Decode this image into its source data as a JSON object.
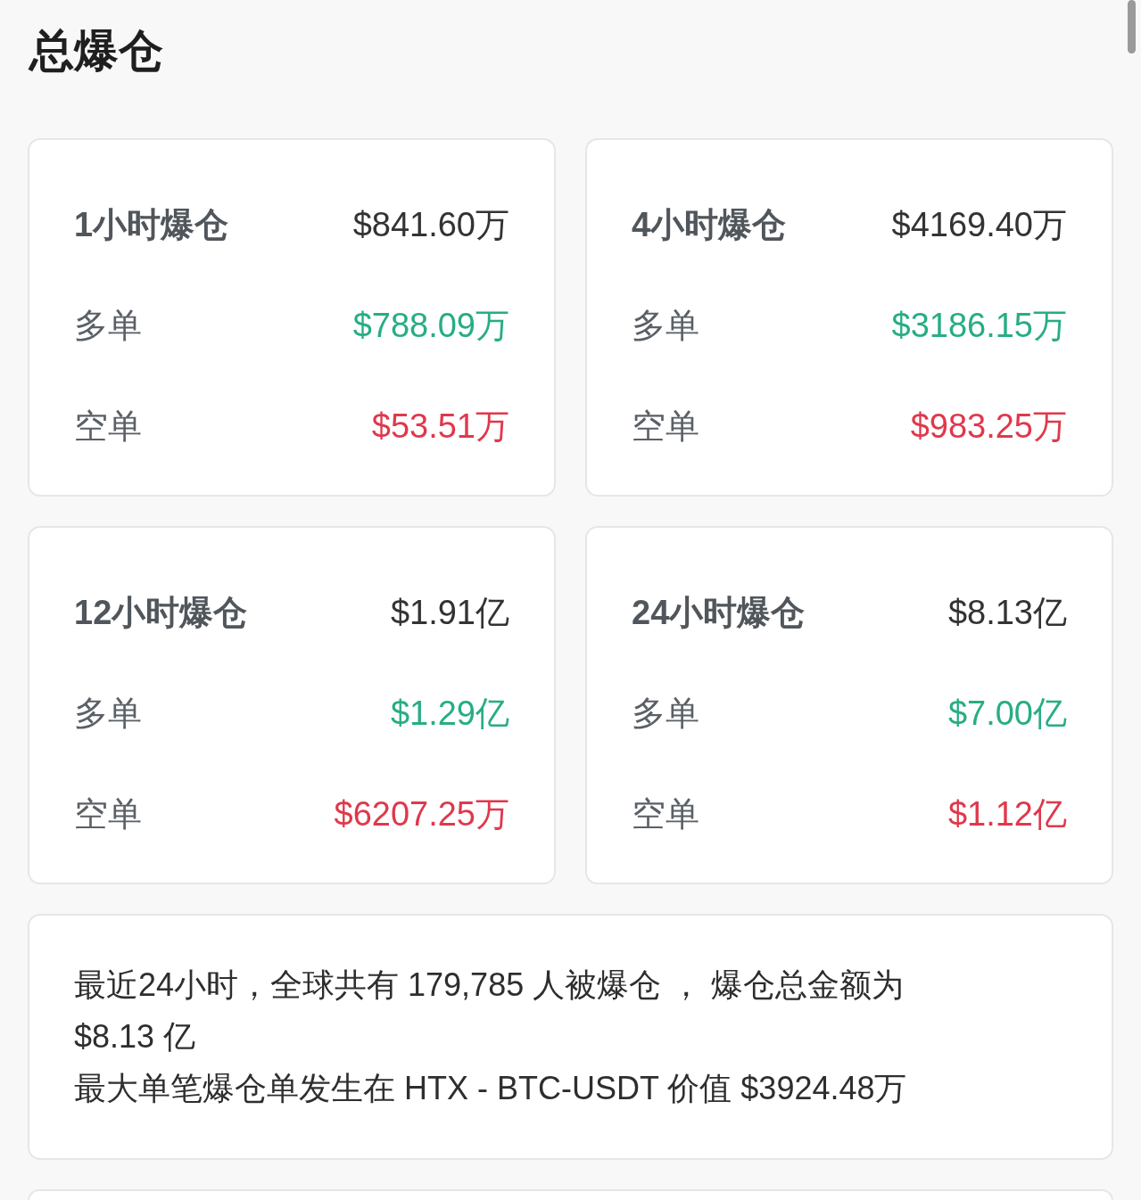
{
  "title": "总爆仓",
  "periods": [
    {
      "label": "1小时爆仓",
      "total": "$841.60万",
      "rows": [
        {
          "kind": "long",
          "label": "多单",
          "value": "$788.09万"
        },
        {
          "kind": "short",
          "label": "空单",
          "value": "$53.51万"
        }
      ]
    },
    {
      "label": "4小时爆仓",
      "total": "$4169.40万",
      "rows": [
        {
          "kind": "long",
          "label": "多单",
          "value": "$3186.15万"
        },
        {
          "kind": "short",
          "label": "空单",
          "value": "$983.25万"
        }
      ]
    },
    {
      "label": "12小时爆仓",
      "total": "$1.91亿",
      "rows": [
        {
          "kind": "long",
          "label": "多单",
          "value": "$1.29亿"
        },
        {
          "kind": "short",
          "label": "空单",
          "value": "$6207.25万"
        }
      ]
    },
    {
      "label": "24小时爆仓",
      "total": "$8.13亿",
      "rows": [
        {
          "kind": "long",
          "label": "多单",
          "value": "$7.00亿"
        },
        {
          "kind": "short",
          "label": "空单",
          "value": "$1.12亿"
        }
      ]
    }
  ],
  "summary": {
    "text": "最近24小时，全球共有 179,785 人被爆仓 ， 爆仓总金额为 $8.13 亿",
    "largest": "最大单笔爆仓单发生在 HTX - BTC-USDT 价值 $3924.48万"
  }
}
